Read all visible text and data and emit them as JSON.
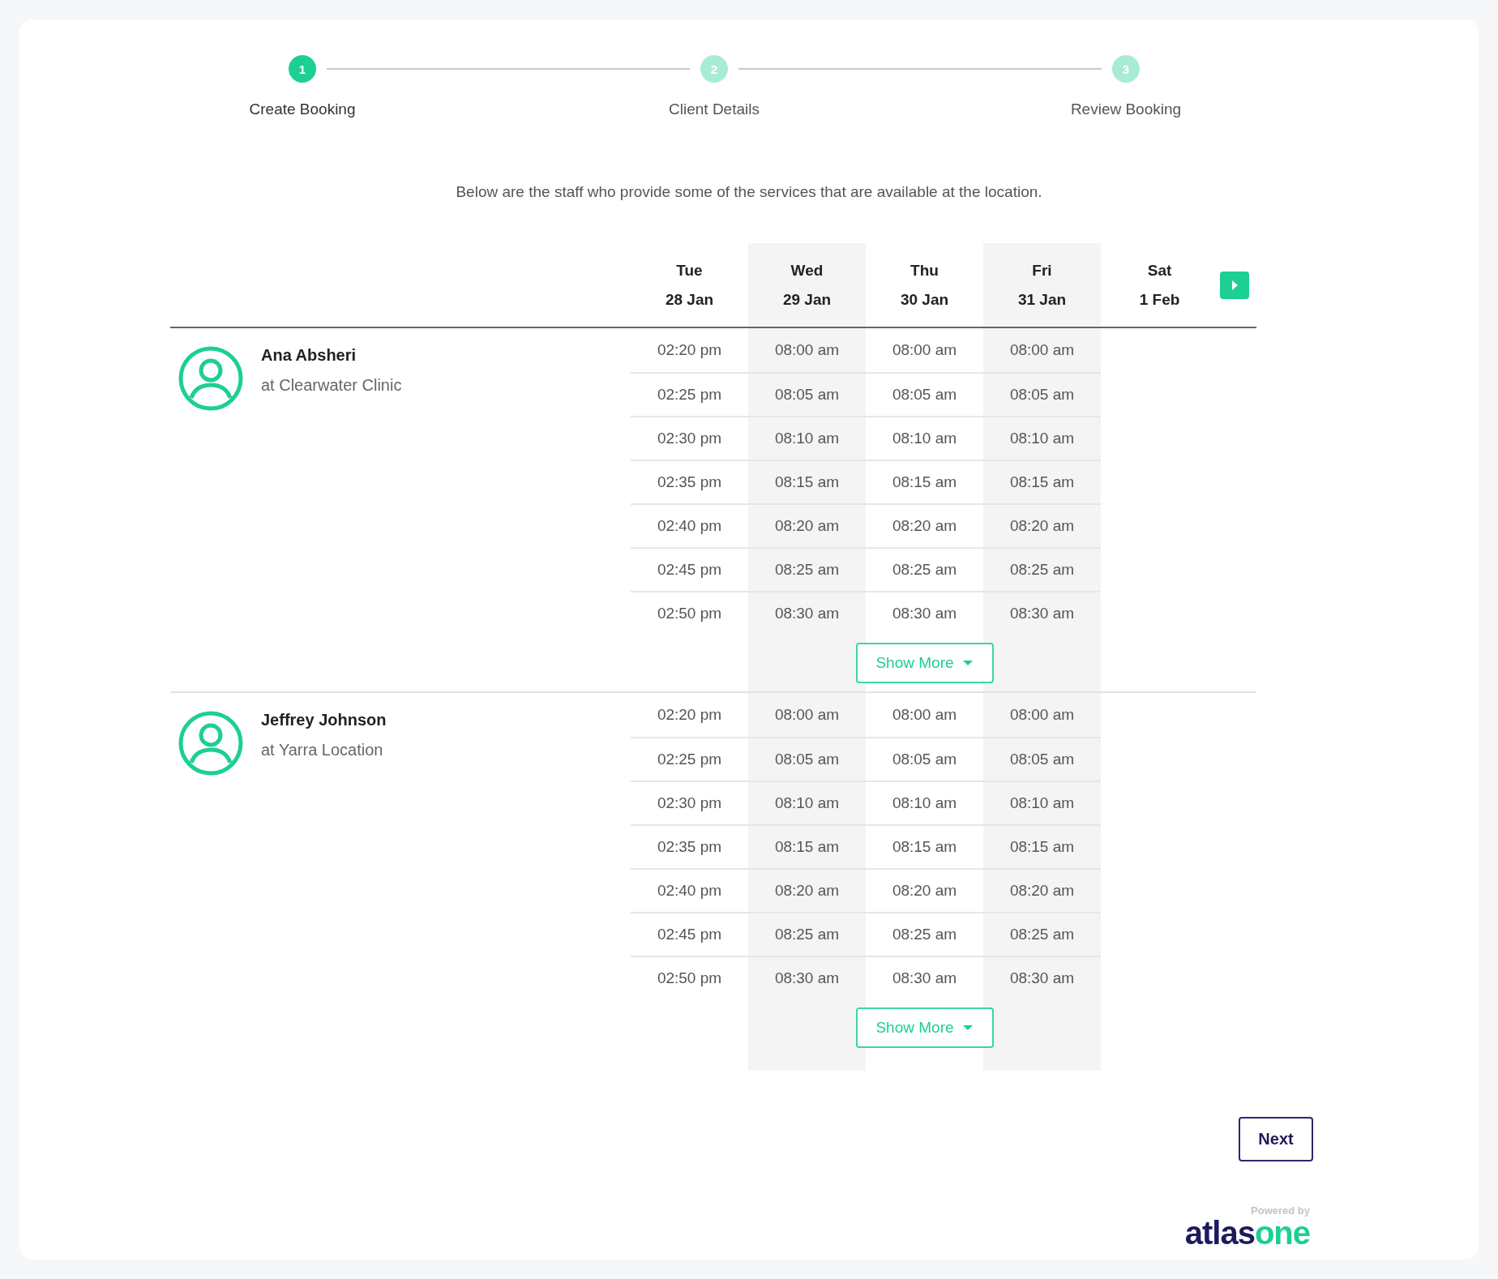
{
  "steps": [
    {
      "number": "1",
      "label": "Create Booking",
      "active": true
    },
    {
      "number": "2",
      "label": "Client Details",
      "active": false
    },
    {
      "number": "3",
      "label": "Review Booking",
      "active": false
    }
  ],
  "description": "Below are the staff who provide some of the services that are available at the location.",
  "days": [
    {
      "weekday": "Tue",
      "date": "28 Jan"
    },
    {
      "weekday": "Wed",
      "date": "29 Jan"
    },
    {
      "weekday": "Thu",
      "date": "30 Jan"
    },
    {
      "weekday": "Fri",
      "date": "31 Jan"
    },
    {
      "weekday": "Sat",
      "date": "1 Feb"
    }
  ],
  "staff": [
    {
      "name": "Ana Absheri",
      "location": "at Clearwater Clinic",
      "show_more": "Show More",
      "slots": [
        [
          "02:20 pm",
          "02:25 pm",
          "02:30 pm",
          "02:35 pm",
          "02:40 pm",
          "02:45 pm",
          "02:50 pm"
        ],
        [
          "08:00 am",
          "08:05 am",
          "08:10 am",
          "08:15 am",
          "08:20 am",
          "08:25 am",
          "08:30 am"
        ],
        [
          "08:00 am",
          "08:05 am",
          "08:10 am",
          "08:15 am",
          "08:20 am",
          "08:25 am",
          "08:30 am"
        ],
        [
          "08:00 am",
          "08:05 am",
          "08:10 am",
          "08:15 am",
          "08:20 am",
          "08:25 am",
          "08:30 am"
        ]
      ]
    },
    {
      "name": "Jeffrey Johnson",
      "location": "at Yarra Location",
      "show_more": "Show More",
      "slots": [
        [
          "02:20 pm",
          "02:25 pm",
          "02:30 pm",
          "02:35 pm",
          "02:40 pm",
          "02:45 pm",
          "02:50 pm"
        ],
        [
          "08:00 am",
          "08:05 am",
          "08:10 am",
          "08:15 am",
          "08:20 am",
          "08:25 am",
          "08:30 am"
        ],
        [
          "08:00 am",
          "08:05 am",
          "08:10 am",
          "08:15 am",
          "08:20 am",
          "08:25 am",
          "08:30 am"
        ],
        [
          "08:00 am",
          "08:05 am",
          "08:10 am",
          "08:15 am",
          "08:20 am",
          "08:25 am",
          "08:30 am"
        ]
      ]
    }
  ],
  "next_button": "Next",
  "footer": {
    "powered_by": "Powered by",
    "logo": [
      "atlas",
      "one"
    ]
  }
}
